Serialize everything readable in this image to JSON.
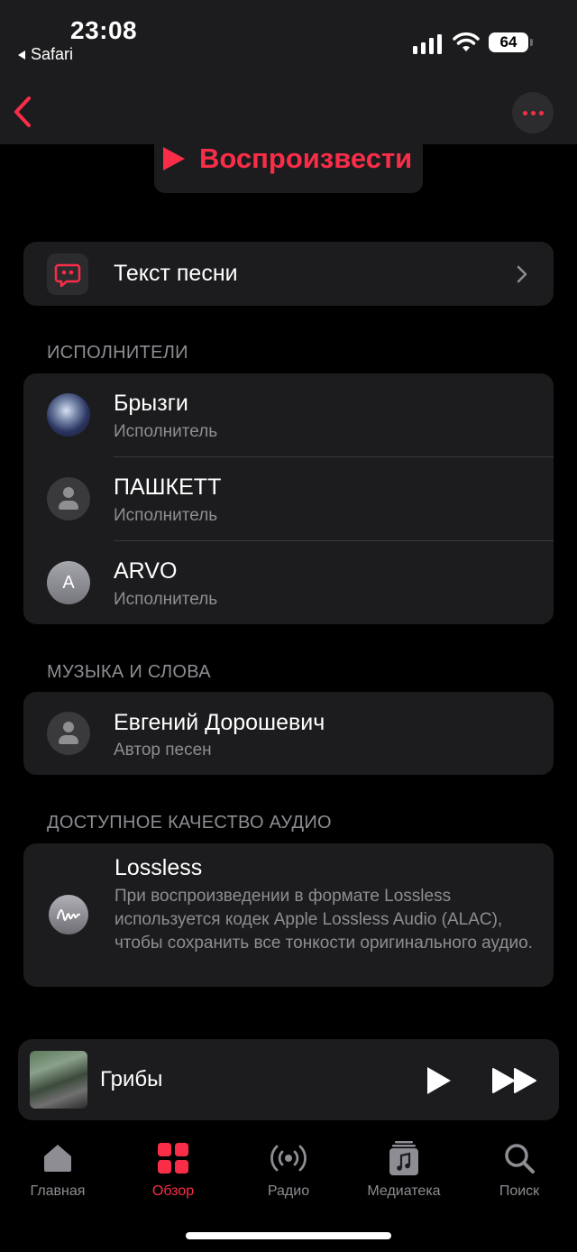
{
  "status_bar": {
    "time": "23:08",
    "back_app": "Safari",
    "battery": "64"
  },
  "header": {
    "play_label": "Воспроизвести"
  },
  "lyrics": {
    "label": "Текст песни"
  },
  "performers": {
    "heading": "ИСПОЛНИТЕЛИ",
    "items": [
      {
        "name": "Брызги",
        "role": "Исполнитель"
      },
      {
        "name": "ПАШКЕТТ",
        "role": "Исполнитель"
      },
      {
        "name": "ARVO",
        "role": "Исполнитель",
        "initial": "A"
      }
    ]
  },
  "composers": {
    "heading": "МУЗЫКА И СЛОВА",
    "items": [
      {
        "name": "Евгений Дорошевич",
        "role": "Автор песен"
      }
    ]
  },
  "audio_quality": {
    "heading": "ДОСТУПНОЕ КАЧЕСТВО АУДИО",
    "title": "Lossless",
    "description": "При воспроизведении в формате Lossless используется кодек Apple Lossless Audio (ALAC), чтобы сохранить все тонкости оригинального аудио."
  },
  "mini_player": {
    "title": "Грибы"
  },
  "tabs": [
    {
      "label": "Главная",
      "icon": "home-icon"
    },
    {
      "label": "Обзор",
      "icon": "browse-grid-icon",
      "active": true
    },
    {
      "label": "Радио",
      "icon": "radio-icon"
    },
    {
      "label": "Медиатека",
      "icon": "library-icon"
    },
    {
      "label": "Поиск",
      "icon": "search-icon"
    }
  ],
  "colors": {
    "accent": "#fa2d48",
    "background": "#000000",
    "card": "#1c1c1e",
    "secondary_text": "#8d8d93"
  }
}
